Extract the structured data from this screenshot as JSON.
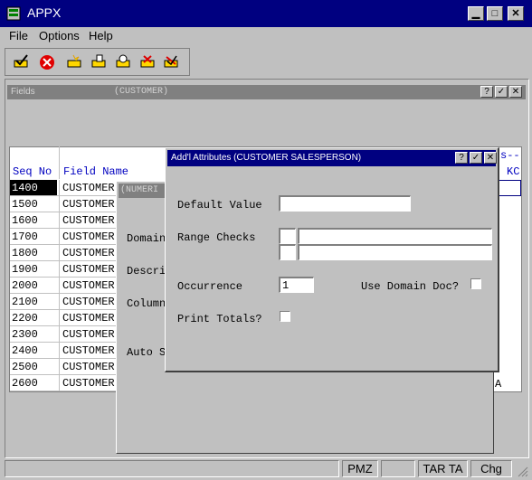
{
  "app": {
    "title": "APPX"
  },
  "menu": [
    "File",
    "Options",
    "Help"
  ],
  "toolbar": {
    "icons": [
      "enter-check-icon",
      "cancel-x-icon",
      "add-icon",
      "change-icon",
      "inquire-icon",
      "delete-icon",
      "reject-icon"
    ]
  },
  "fields_window": {
    "title": "Fields",
    "subtitle": "(CUSTOMER)",
    "col_seq": "Seq No",
    "col_field": "Field Name",
    "col_right_top": "s--",
    "col_right_bottom": "KC",
    "rows": [
      {
        "seq": "1400",
        "name": "CUSTOMER"
      },
      {
        "seq": "1500",
        "name": "CUSTOMER"
      },
      {
        "seq": "1600",
        "name": "CUSTOMER"
      },
      {
        "seq": "1700",
        "name": "CUSTOMER"
      },
      {
        "seq": "1800",
        "name": "CUSTOMER"
      },
      {
        "seq": "1900",
        "name": "CUSTOMER"
      },
      {
        "seq": "2000",
        "name": "CUSTOMER"
      },
      {
        "seq": "2100",
        "name": "CUSTOMER"
      },
      {
        "seq": "2200",
        "name": "CUSTOMER"
      },
      {
        "seq": "2300",
        "name": "CUSTOMER"
      },
      {
        "seq": "2400",
        "name": "CUSTOMER"
      },
      {
        "seq": "2500",
        "name": "CUSTOMER"
      },
      {
        "seq": "2600",
        "name": "CUSTOMER"
      }
    ],
    "last_row_right": "A"
  },
  "middle_window": {
    "title": "(NUMERI",
    "labels": [
      "Domain",
      "Descri",
      "Column",
      "Auto S"
    ]
  },
  "dialog": {
    "title": "Add'l Attributes  (CUSTOMER SALESPERSON)",
    "default_value_label": "Default Value",
    "default_value": "",
    "range_checks_label": "Range Checks",
    "occurrence_label": "Occurrence",
    "occurrence_value": "1",
    "use_domain_doc_label": "Use Domain Doc?",
    "print_totals_label": "Print Totals?"
  },
  "statusbar": {
    "cells": [
      "",
      "PMZ",
      "",
      "TAR TA",
      "Chg"
    ]
  },
  "colors": {
    "title": "#000080",
    "window": "#c0c0c0",
    "subtitle": "#808080",
    "selected": "#000000"
  }
}
